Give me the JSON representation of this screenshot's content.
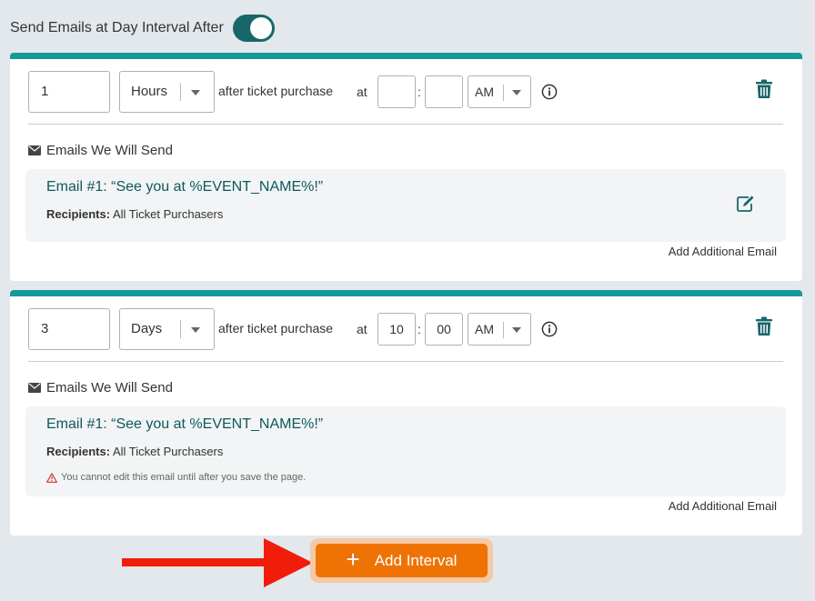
{
  "header": {
    "toggle_label": "Send Emails at Day Interval After",
    "toggle_on": true
  },
  "intervals": [
    {
      "amount": "1",
      "unit": "Hours",
      "after_text": "after ticket purchase",
      "at_label": "at",
      "hour": "",
      "minute": "",
      "colon": ":",
      "meridiem": "AM",
      "emails_heading": "Emails We Will Send",
      "email": {
        "title": "Email #1: “See you at %EVENT_NAME%!”",
        "recipients_label": "Recipients:",
        "recipients_value": "All Ticket Purchasers",
        "warning": ""
      },
      "add_email_label": "Add Additional Email"
    },
    {
      "amount": "3",
      "unit": "Days",
      "after_text": "after ticket purchase",
      "at_label": "at",
      "hour": "10",
      "minute": "00",
      "colon": ":",
      "meridiem": "AM",
      "emails_heading": "Emails We Will Send",
      "email": {
        "title": "Email #1: “See you at %EVENT_NAME%!”",
        "recipients_label": "Recipients:",
        "recipients_value": "All Ticket Purchasers",
        "warning": "You cannot edit this email until after you save the page."
      },
      "add_email_label": "Add Additional Email"
    }
  ],
  "add_interval": {
    "icon": "plus",
    "label": "Add Interval"
  },
  "colors": {
    "teal_accent": "#17989b",
    "toggle_teal": "#17676a",
    "title_teal": "#10585a",
    "orange_button": "#ee7304",
    "arrow_red": "#f21c0a"
  }
}
